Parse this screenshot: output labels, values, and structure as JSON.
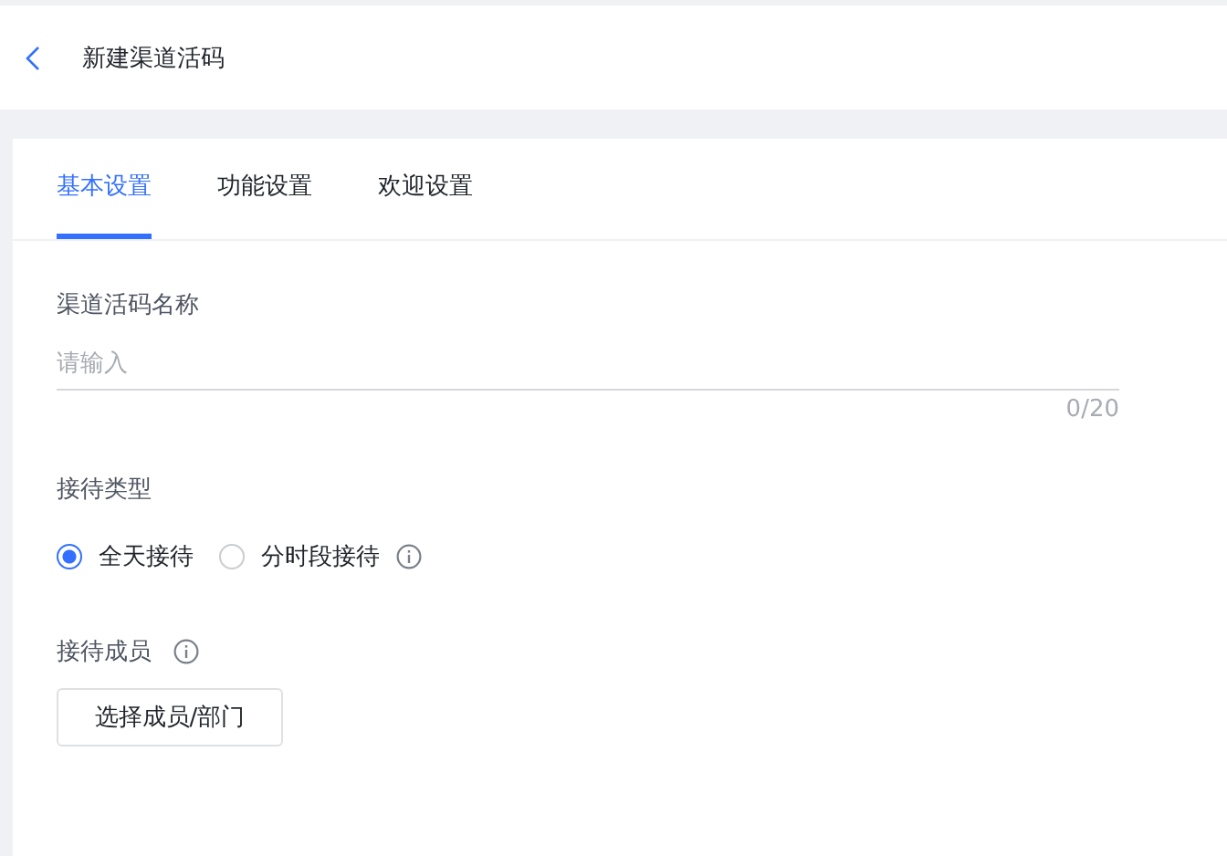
{
  "header": {
    "title": "新建渠道活码"
  },
  "tabs": [
    {
      "label": "基本设置",
      "selected": true
    },
    {
      "label": "功能设置",
      "selected": false
    },
    {
      "label": "欢迎设置",
      "selected": false
    }
  ],
  "name_field": {
    "label": "渠道活码名称",
    "placeholder": "请输入",
    "counter": "0/20"
  },
  "reception_type": {
    "label": "接待类型",
    "options": [
      {
        "label": "全天接待",
        "selected": true,
        "info": false
      },
      {
        "label": "分时段接待",
        "selected": false,
        "info": true
      }
    ]
  },
  "members": {
    "label": "接待成员",
    "info": true,
    "button": "选择成员/部门"
  }
}
